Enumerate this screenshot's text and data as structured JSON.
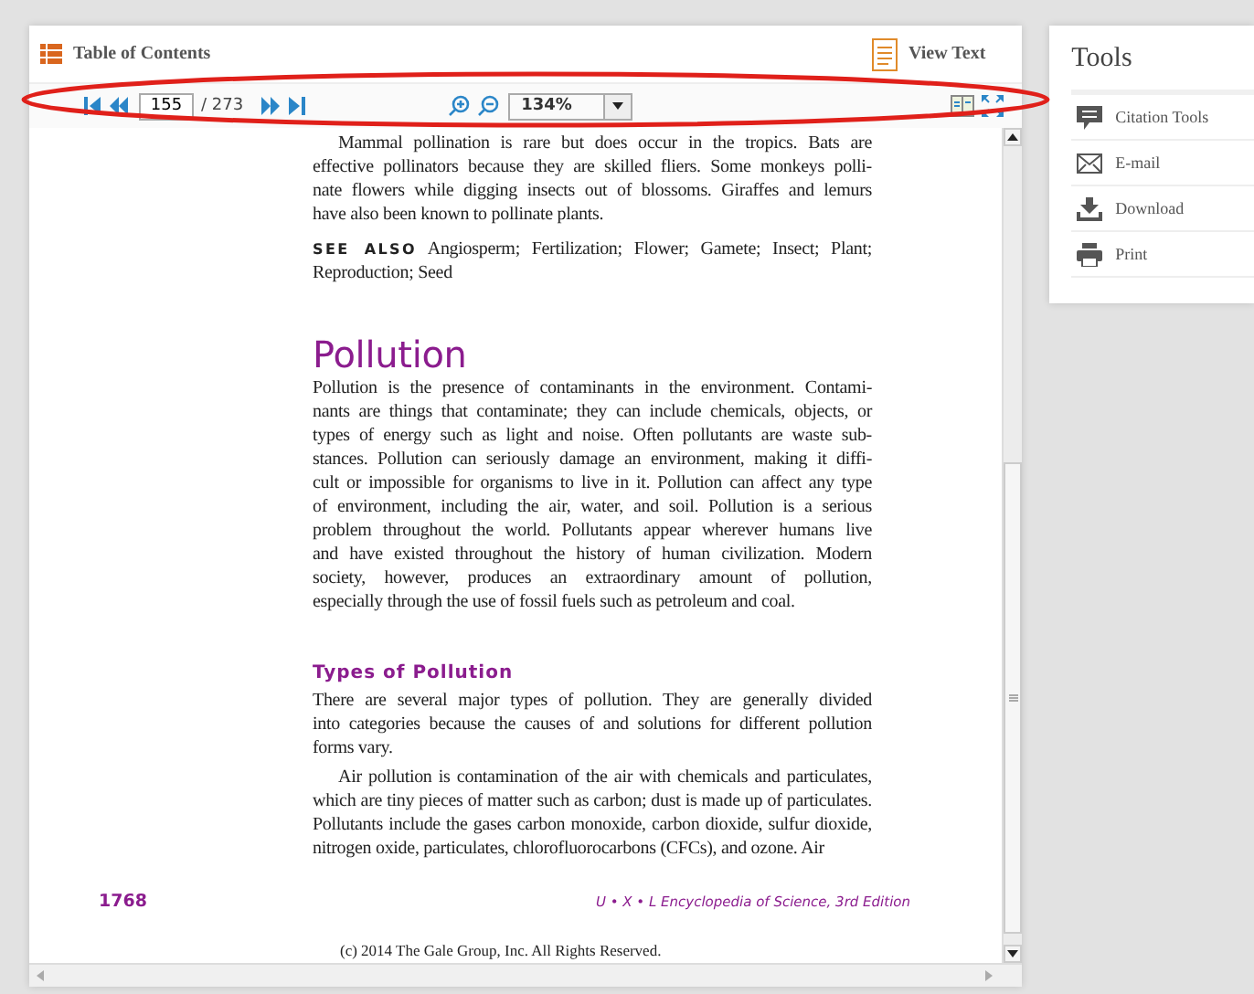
{
  "header": {
    "toc_label": "Table of Contents",
    "view_text_label": "View Text"
  },
  "toolbar": {
    "page": "155",
    "total": "/ 273",
    "zoom": "134%"
  },
  "page": {
    "blocks": [
      {
        "kind": "paragraph",
        "indent": true,
        "lines": [
          "Mammal pollination is rare but does occur in the tropics. Bats are",
          "effective pollinators because they are skilled fliers. Some monkeys polli-",
          "nate flowers while digging insects out of blossoms. Giraffes and lemurs",
          "have also been known to pollinate plants."
        ]
      },
      {
        "kind": "see_also",
        "label": "SEE ALSO",
        "lines": [
          "Angiosperm; Fertilization; Flower; Gamete; Insect; Plant;",
          "Reproduction; Seed"
        ]
      },
      {
        "kind": "heading",
        "text": "Pollution"
      },
      {
        "kind": "paragraph",
        "indent": false,
        "lines": [
          "Pollution is the presence of contaminants in the environment. Contami-",
          "nants are things that contaminate; they can include chemicals, objects, or",
          "types of energy such as light and noise. Often pollutants are waste sub-",
          "stances. Pollution can seriously damage an environment, making it diffi-",
          "cult or impossible for organisms to live in it. Pollution can affect any type",
          "of environment, including the air, water, and soil. Pollution is a serious",
          "problem throughout the world. Pollutants appear wherever humans live",
          "and have existed throughout the history of human civilization. Modern",
          "society, however, produces an extraordinary amount of pollution,",
          "especially through the use of fossil fuels such as petroleum and coal."
        ]
      },
      {
        "kind": "subheading",
        "text": "Types of Pollution"
      },
      {
        "kind": "paragraph",
        "indent": false,
        "lines": [
          "There are several major types of pollution. They are generally divided",
          "into categories because the causes of and solutions for different pollution",
          "forms vary."
        ]
      },
      {
        "kind": "paragraph",
        "indent": true,
        "lines": [
          "Air pollution is contamination of the air with chemicals and particulates,",
          "which are tiny pieces of matter such as carbon; dust is made up of particulates.",
          "Pollutants include the gases carbon monoxide, carbon dioxide, sulfur dioxide,",
          "nitrogen oxide, particulates, chlorofluorocarbons (CFCs), and ozone. Air"
        ]
      }
    ],
    "page_number": "1768",
    "book_title": "U • X • L Encyclopedia of Science, 3rd Edition",
    "copyright": "(c) 2014 The Gale Group, Inc. All Rights Reserved."
  },
  "tools": {
    "title": "Tools",
    "items": [
      {
        "kind": "citation",
        "label": "Citation Tools"
      },
      {
        "kind": "email",
        "label": "E-mail"
      },
      {
        "kind": "download",
        "label": "Download"
      },
      {
        "kind": "print",
        "label": "Print"
      }
    ]
  }
}
